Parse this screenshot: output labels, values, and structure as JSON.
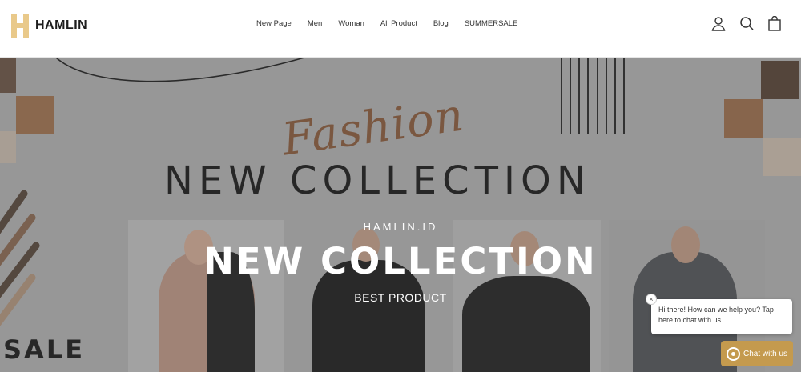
{
  "brand": {
    "name": "HAMLIN"
  },
  "nav": {
    "items": [
      {
        "label": "New Page"
      },
      {
        "label": "Men"
      },
      {
        "label": "Woman"
      },
      {
        "label": "All Product"
      },
      {
        "label": "Blog"
      },
      {
        "label": "SUMMERSALE"
      }
    ]
  },
  "header_icons": [
    {
      "name": "account-icon"
    },
    {
      "name": "search-icon"
    },
    {
      "name": "cart-icon"
    }
  ],
  "hero": {
    "image_text": {
      "script": "Fashion",
      "title": "NEW COLLECTION",
      "sale": "SALE"
    },
    "kicker": "HAMLIN.ID",
    "headline": "NEW COLLECTION",
    "subheadline": "BEST PRODUCT"
  },
  "chat": {
    "message": "Hi there! How can we help you? Tap here to chat with us.",
    "button_label": "Chat with us",
    "close_label": "×"
  },
  "colors": {
    "accent": "#c49a4e",
    "logo": "#e9c98a",
    "brown": "#8f5f3f"
  }
}
